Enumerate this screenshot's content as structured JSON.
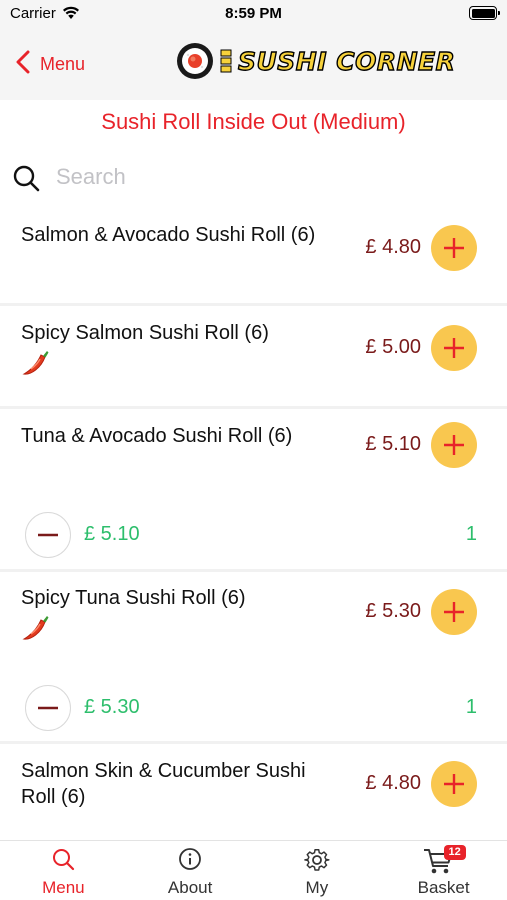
{
  "status_bar": {
    "carrier": "Carrier",
    "time": "8:59 PM"
  },
  "nav": {
    "back_label": "Menu",
    "logo_text": "SUSHI CORNER"
  },
  "category_title": "Sushi Roll Inside Out (Medium)",
  "search": {
    "placeholder": "Search",
    "value": ""
  },
  "items": [
    {
      "name": "Salmon & Avocado Sushi Roll (6)",
      "price": "£ 4.80",
      "spicy": false
    },
    {
      "name": "Spicy Salmon Sushi Roll (6)",
      "price": "£ 5.00",
      "spicy": true
    },
    {
      "name": "Tuna & Avocado Sushi Roll (6)",
      "price": "£ 5.10",
      "spicy": false,
      "in_basket": {
        "line_total": "£ 5.10",
        "quantity": "1"
      }
    },
    {
      "name": "Spicy Tuna Sushi Roll (6)",
      "price": "£ 5.30",
      "spicy": true,
      "in_basket": {
        "line_total": "£ 5.30",
        "quantity": "1"
      }
    },
    {
      "name": "Salmon Skin & Cucumber Sushi Roll (6)",
      "price": "£ 4.80",
      "spicy": false
    }
  ],
  "tabs": [
    {
      "label": "Menu",
      "icon": "search-icon",
      "active": true
    },
    {
      "label": "About",
      "icon": "info-icon",
      "active": false
    },
    {
      "label": "My",
      "icon": "gear-icon",
      "active": false
    },
    {
      "label": "Basket",
      "icon": "cart-icon",
      "active": false,
      "badge": "12"
    }
  ],
  "colors": {
    "accent_red": "#e8232a",
    "price": "#7a1a1a",
    "add_button": "#f9c74f",
    "basket_green": "#2dbe6c"
  }
}
